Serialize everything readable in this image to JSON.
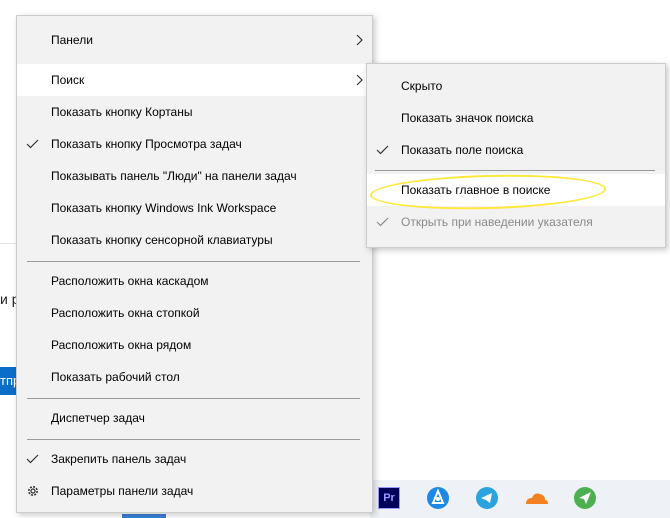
{
  "background": {
    "left_text": "и р",
    "left_button": "тпр"
  },
  "main_menu": {
    "items": [
      {
        "label": "Панели",
        "has_submenu": true
      },
      {
        "label": "Поиск",
        "has_submenu": true,
        "active": true
      },
      {
        "label": "Показать кнопку Кортаны"
      },
      {
        "label": "Показать кнопку Просмотра задач",
        "checked": true
      },
      {
        "label": "Показывать панель \"Люди\" на панели задач"
      },
      {
        "label": "Показать кнопку Windows Ink Workspace"
      },
      {
        "label": "Показать кнопку сенсорной клавиатуры"
      },
      {
        "label": "Расположить окна каскадом"
      },
      {
        "label": "Расположить окна стопкой"
      },
      {
        "label": "Расположить окна рядом"
      },
      {
        "label": "Показать рабочий стол"
      },
      {
        "label": "Диспетчер задач"
      },
      {
        "label": "Закрепить панель задач",
        "checked": true
      },
      {
        "label": "Параметры панели задач",
        "icon": "gear-icon"
      }
    ]
  },
  "search_submenu": {
    "items": [
      {
        "label": "Скрыто"
      },
      {
        "label": "Показать значок поиска"
      },
      {
        "label": "Показать поле поиска",
        "checked": true
      },
      {
        "label": "Показать главное в поиске",
        "active": true,
        "highlighted": true
      },
      {
        "label": "Открыть при наведении указателя",
        "checked": true,
        "disabled": true
      }
    ]
  },
  "taskbar": {
    "icons": [
      {
        "name": "premiere-pro-icon",
        "text": "Pr",
        "color": "#00005b",
        "accent": "#9999ff"
      },
      {
        "name": "blue-app-icon",
        "color": "#1e88e5"
      },
      {
        "name": "telegram-icon",
        "color": "#2aa3df"
      },
      {
        "name": "cloudflare-icon",
        "color": "#f48120"
      },
      {
        "name": "paper-plane-app-icon",
        "color": "#4caf50"
      }
    ]
  }
}
